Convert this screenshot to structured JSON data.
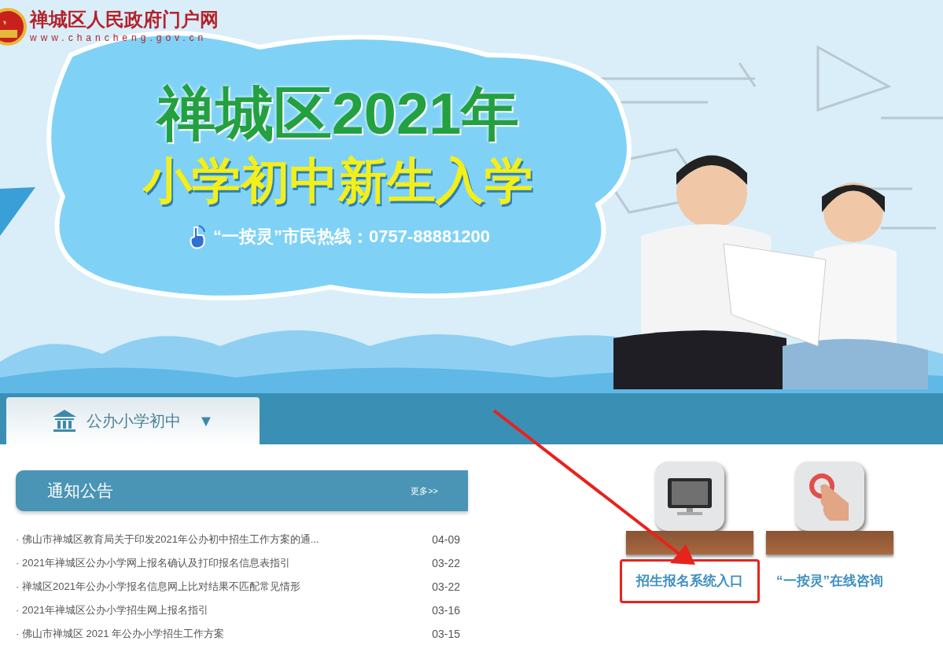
{
  "site": {
    "title": "禅城区人民政府门户网",
    "url": "www.chancheng.gov.cn"
  },
  "banner": {
    "title": "禅城区2021年",
    "subtitle": "小学初中新生入学",
    "hotline": "“一按灵”市民热线：0757-88881200"
  },
  "tabs": [
    {
      "label": "公办小学初中",
      "caret": "▼",
      "selected": true
    }
  ],
  "notices": {
    "title": "通知公告",
    "more": "更多>>",
    "items": [
      {
        "title": "· 佛山市禅城区教育局关于印发2021年公办初中招生工作方案的通...",
        "date": "04-09"
      },
      {
        "title": "· 2021年禅城区公办小学网上报名确认及打印报名信息表指引",
        "date": "03-22"
      },
      {
        "title": "· 禅城区2021年公办小学报名信息网上比对结果不匹配常见情形",
        "date": "03-22"
      },
      {
        "title": "· 2021年禅城区公办小学招生网上报名指引",
        "date": "03-16"
      },
      {
        "title": "· 佛山市禅城区 2021 年公办小学招生工作方案",
        "date": "03-15"
      }
    ]
  },
  "entries": [
    {
      "kind": "computer",
      "label": "招生报名系统入口",
      "highlighted": true
    },
    {
      "kind": "hand",
      "label": "“一按灵”在线咨询",
      "highlighted": false
    }
  ]
}
